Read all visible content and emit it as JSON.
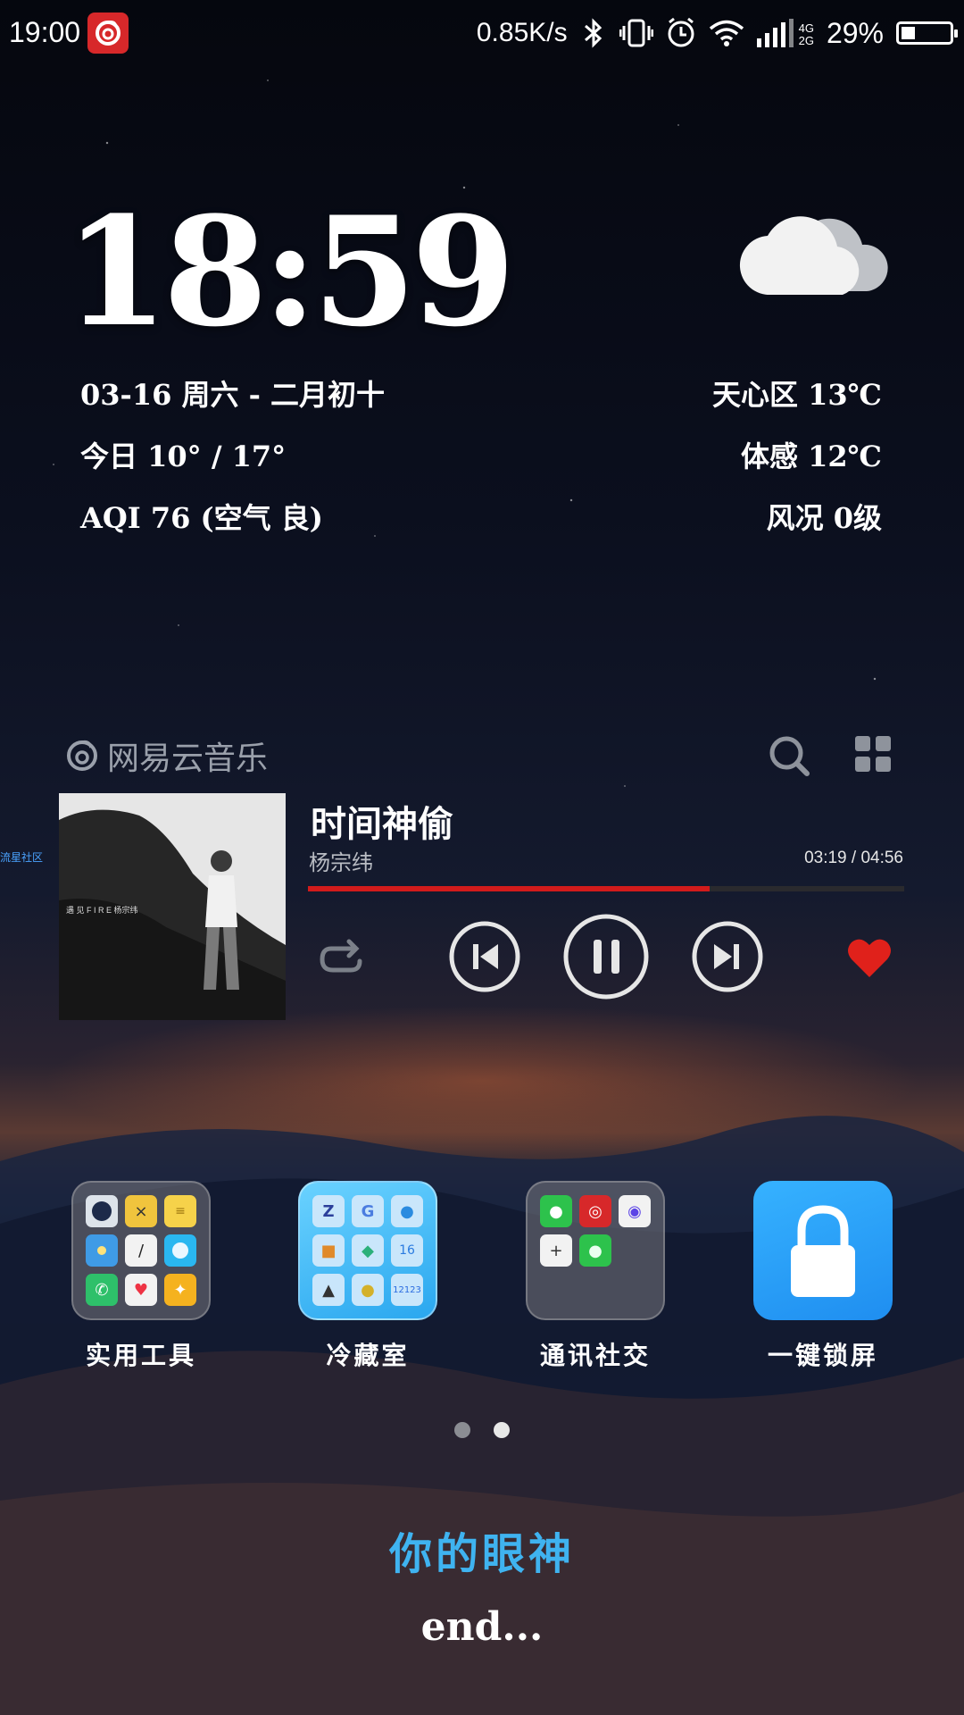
{
  "status_bar": {
    "time": "19:00",
    "app_icon": "netease-music-icon",
    "net_speed": "0.85K/s",
    "signal_small": [
      "4G",
      "2G"
    ],
    "battery": "29%",
    "battery_level": 0.29,
    "icons": [
      "bluetooth-icon",
      "vibrate-icon",
      "alarm-icon",
      "wifi-icon",
      "signal-icon",
      "battery-icon"
    ]
  },
  "clock_widget": {
    "time": "18:59",
    "date": "03-16 周六 - 二月初十",
    "temp_range": "今日 10° / 17°",
    "aqi": "AQI 76 (空气 良)",
    "location_temp": "天心区 13℃",
    "feels_like": "体感 12℃",
    "wind": "风况 0级",
    "weather_icon": "cloud-icon"
  },
  "music_widget": {
    "brand": "网易云音乐",
    "song": "时间神偷",
    "artist": "杨宗纬",
    "time": "03:19 / 04:56",
    "progress": 0.674,
    "accent": "#d21b1b",
    "album_text": "遇 见 F I R E   杨宗纬"
  },
  "side_label": "流星社区",
  "apps": [
    {
      "label": "实用工具"
    },
    {
      "label": "冷藏室"
    },
    {
      "label": "通讯社交"
    },
    {
      "label": "一键锁屏"
    }
  ],
  "page_dots": {
    "count": 2,
    "active": 1
  },
  "lyric": "你的眼神",
  "end_text": "end..."
}
